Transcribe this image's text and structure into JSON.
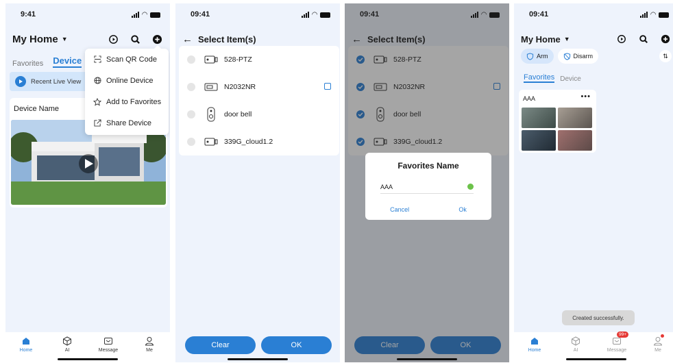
{
  "screens": {
    "home": {
      "status_time": "9:41",
      "title": "My Home",
      "tabs": [
        "Favorites",
        "Device"
      ],
      "recent_live": "Recent Live View",
      "device_name": "Device Name",
      "menu": [
        "Scan QR Code",
        "Online Device",
        "Add to Favorites",
        "Share Device"
      ]
    },
    "select": {
      "status_time": "09:41",
      "title": "Select Item(s)",
      "items": [
        "528-PTZ",
        "N2032NR",
        "door bell",
        "339G_cloud1.2"
      ],
      "clear_label": "Clear",
      "ok_label": "OK"
    },
    "dialog": {
      "status_time": "09:41",
      "title": "Select Item(s)",
      "items": [
        "528-PTZ",
        "N2032NR",
        "door bell",
        "339G_cloud1.2"
      ],
      "dialog_title": "Favorites Name",
      "input_value": "AAA",
      "cancel_label": "Cancel",
      "ok_label": "Ok",
      "clear_label": "Clear",
      "btn_ok_label": "OK"
    },
    "result": {
      "status_time": "09:41",
      "title": "My Home",
      "arm_label": "Arm",
      "disarm_label": "Disarm",
      "tabs": [
        "Favorites",
        "Device"
      ],
      "fav_name": "AAA",
      "toast": "Created successfully.",
      "message_badge": "99+"
    }
  },
  "nav": [
    "Home",
    "AI",
    "Message",
    "Me"
  ],
  "colors": {
    "accent": "#2a7fd4",
    "background": "#eef3fc",
    "success": "#6cc24a",
    "badge": "#e53935"
  }
}
